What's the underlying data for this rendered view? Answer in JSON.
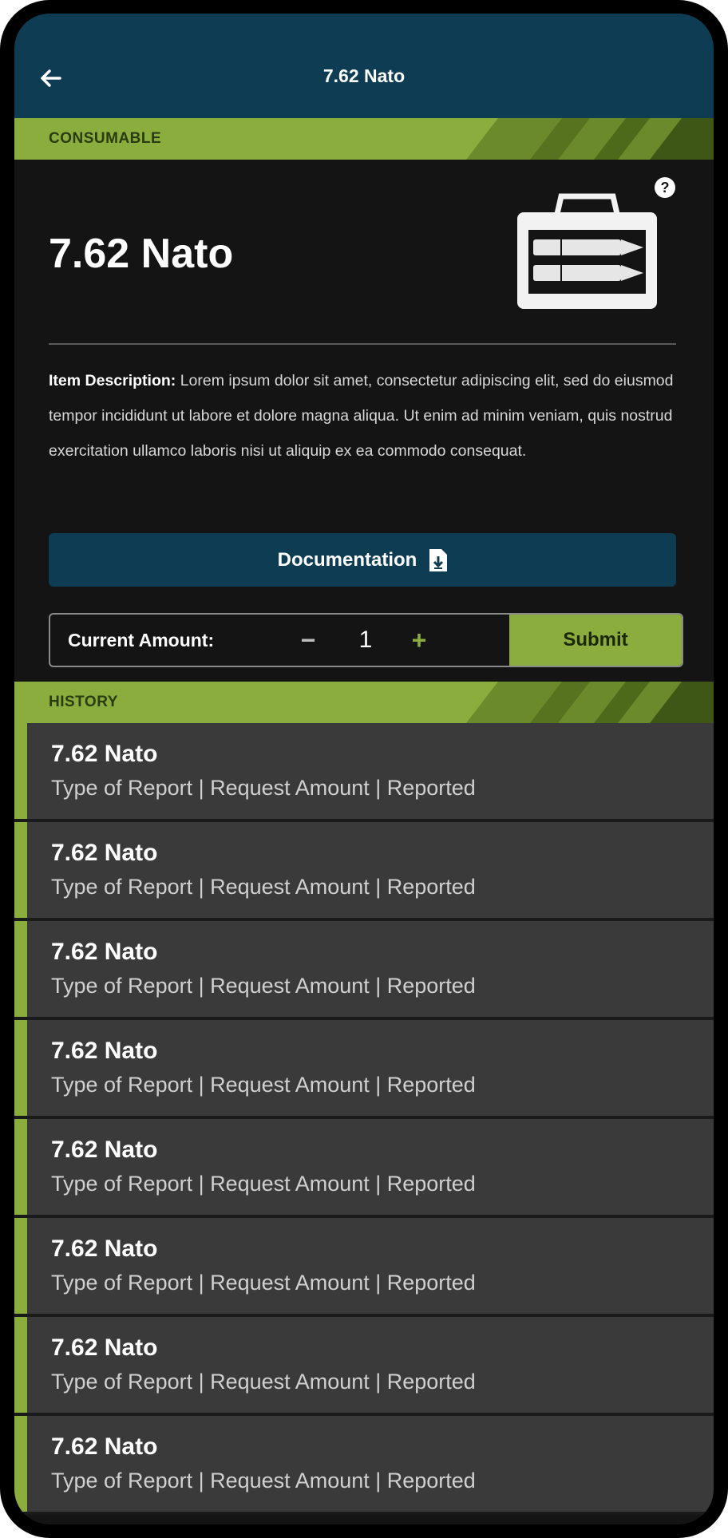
{
  "header": {
    "title": "7.62 Nato",
    "background_color": "#0e3c53"
  },
  "consumable_section": {
    "label": "CONSUMABLE",
    "accent_color": "#8bad3d"
  },
  "item": {
    "title": "7.62 Nato",
    "image_icon": "ammo-crate-icon",
    "description_label": "Item Description:",
    "description_text": " Lorem ipsum dolor sit amet, consectetur adipiscing elit, sed do eiusmod tempor incididunt ut labore et dolore magna aliqua. Ut enim ad minim veniam, quis nostrud exercitation ullamco laboris nisi ut aliquip ex ea commodo consequat."
  },
  "documentation": {
    "label": "Documentation",
    "icon": "file-download-icon"
  },
  "amount": {
    "label": "Current Amount:",
    "minus": "−",
    "value": "1",
    "plus": "+",
    "submit_label": "Submit"
  },
  "history_section": {
    "label": "HISTORY"
  },
  "history": [
    {
      "title": "7.62 Nato",
      "subtitle": "Type of Report | Request Amount | Reported"
    },
    {
      "title": "7.62 Nato",
      "subtitle": "Type of Report | Request Amount | Reported"
    },
    {
      "title": "7.62 Nato",
      "subtitle": "Type of Report | Request Amount | Reported"
    },
    {
      "title": "7.62 Nato",
      "subtitle": "Type of Report | Request Amount | Reported"
    },
    {
      "title": "7.62 Nato",
      "subtitle": "Type of Report | Request Amount | Reported"
    },
    {
      "title": "7.62 Nato",
      "subtitle": "Type of Report | Request Amount | Reported"
    },
    {
      "title": "7.62 Nato",
      "subtitle": "Type of Report | Request Amount | Reported"
    },
    {
      "title": "7.62 Nato",
      "subtitle": "Type of Report | Request Amount | Reported"
    }
  ]
}
